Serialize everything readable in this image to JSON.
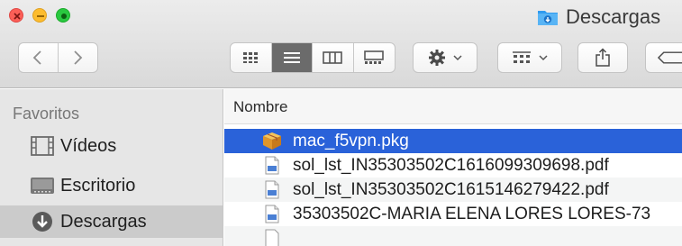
{
  "window": {
    "title": "Descargas",
    "title_icon": "downloads-folder-icon"
  },
  "toolbar": {
    "nav": [
      "chevron-left-icon",
      "chevron-right-icon"
    ],
    "view_modes": [
      {
        "name": "icon-view-icon",
        "active": false
      },
      {
        "name": "list-view-icon",
        "active": true
      },
      {
        "name": "column-view-icon",
        "active": false
      },
      {
        "name": "gallery-view-icon",
        "active": false
      }
    ],
    "action": "gear-icon",
    "group": "group-by-icon",
    "share": "share-icon",
    "tags": "tag-icon"
  },
  "sidebar": {
    "heading": "Favoritos",
    "items": [
      {
        "label": "Vídeos",
        "icon": "film-icon",
        "selected": false
      },
      {
        "label": "Escritorio",
        "icon": "desktop-icon",
        "selected": false
      },
      {
        "label": "Descargas",
        "icon": "download-circle-icon",
        "selected": true
      }
    ]
  },
  "file_list": {
    "column_header": "Nombre",
    "rows": [
      {
        "name": "mac_f5vpn.pkg",
        "icon": "package-icon",
        "selected": true
      },
      {
        "name": "sol_lst_IN35303502C1616099309698.pdf",
        "icon": "pdf-icon",
        "selected": false
      },
      {
        "name": "sol_lst_IN35303502C1615146279422.pdf",
        "icon": "pdf-icon",
        "selected": false
      },
      {
        "name": "35303502C-MARIA ELENA LORES LORES-73",
        "icon": "pdf-icon",
        "selected": false
      }
    ]
  },
  "colors": {
    "selection": "#2a62d9",
    "sidebar_bg": "#e6e6e6",
    "toolbar_bg": "#dedede"
  }
}
